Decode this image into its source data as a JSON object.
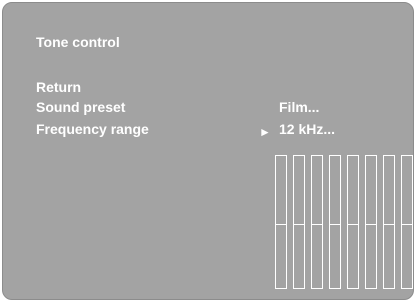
{
  "screen": {
    "title": "Tone control",
    "menu": [
      {
        "label": "Return",
        "value": ""
      },
      {
        "label": "Sound preset",
        "value": "Film..."
      },
      {
        "label": "Frequency range",
        "value": "12 kHz..."
      }
    ],
    "selected_arrow": "►"
  },
  "equalizer": {
    "band_count": 8,
    "levels": [
      0,
      0,
      0,
      0,
      0,
      0,
      0,
      0
    ]
  },
  "colors": {
    "background": "#a3a3a3",
    "text": "#ffffff"
  }
}
